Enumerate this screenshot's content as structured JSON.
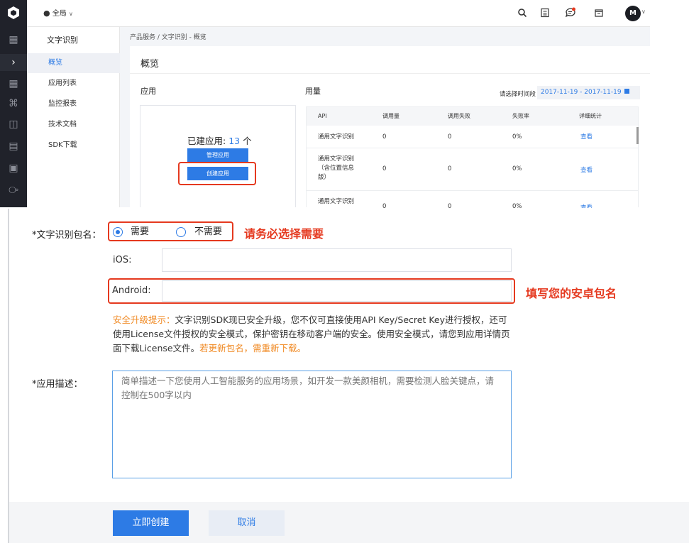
{
  "topbar": {
    "scope_label": "全局",
    "avatar_letter": "M"
  },
  "leftnav": {
    "title": "文字识别",
    "items": [
      {
        "label": "概览"
      },
      {
        "label": "应用列表"
      },
      {
        "label": "监控报表"
      },
      {
        "label": "技术文档"
      },
      {
        "label": "SDK下载"
      }
    ]
  },
  "breadcrumb": "产品服务 / 文字识别 - 概览",
  "page_title": "概览",
  "apps": {
    "section_title": "应用",
    "created_label": "已建应用: ",
    "created_count": "13",
    "created_unit": " 个",
    "manage_button": "管理应用",
    "create_button": "创建应用"
  },
  "usage": {
    "section_title": "用量",
    "range_label": "请选择时间段",
    "range_value": "2017-11-19 - 2017-11-19",
    "columns": [
      "API",
      "调用量",
      "调用失败",
      "失败率",
      "详细统计"
    ],
    "rows": [
      {
        "api": "通用文字识别",
        "calls": "0",
        "failures": "0",
        "rate": "0%",
        "detail": "查看"
      },
      {
        "api": "通用文字识别（含位置信息版）",
        "calls": "0",
        "failures": "0",
        "rate": "0%",
        "detail": "查看"
      },
      {
        "api": "通用文字识别",
        "calls": "0",
        "failures": "0",
        "rate": "0%",
        "detail": "查看"
      }
    ]
  },
  "form": {
    "package_label": "*文字识别包名：",
    "radio_need": "需要",
    "radio_not_need": "不需要",
    "note_select": "请务必选择需要",
    "ios_label": "iOS:",
    "android_label": "Android:",
    "note_android": "填写您的安卓包名",
    "tip_prefix": "安全升级提示：",
    "tip_body": "文字识别SDK现已安全升级，您不仅可直接使用API Key/Secret Key进行授权，还可使用License文件授权的安全模式，保护密钥在移动客户端的安全。使用安全模式，请您到应用详情页面下载License文件。",
    "tip_suffix": "若更新包名，需重新下载。",
    "desc_label": "*应用描述：",
    "desc_placeholder": "简单描述一下您使用人工智能服务的应用场景，如开发一款美颜相机，需要检测人脸关键点，请控制在500字以内",
    "submit_button": "立即创建",
    "cancel_button": "取消"
  },
  "colors": {
    "accent": "#2d7be5",
    "annotation_red": "#e5391f",
    "tip_orange": "#f08a24",
    "sidebar_dark": "#20222a"
  }
}
